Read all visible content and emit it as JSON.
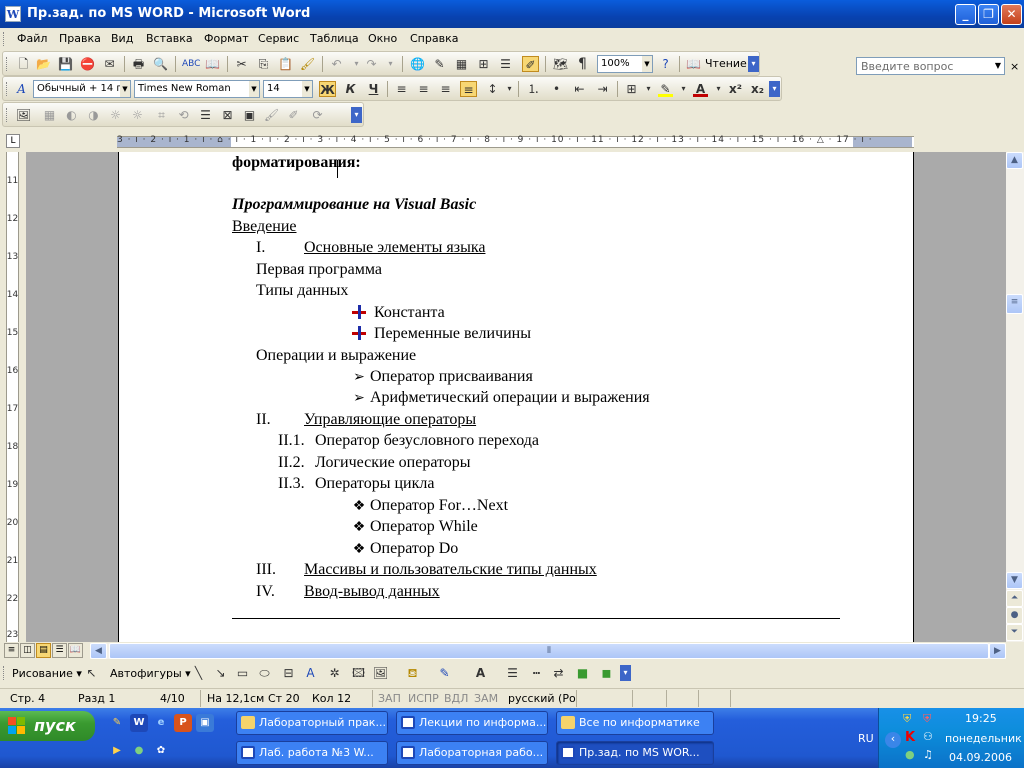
{
  "window": {
    "title": "Пр.зад. по MS WORD - Microsoft Word",
    "app_icon": "W"
  },
  "menu": [
    "Файл",
    "Правка",
    "Вид",
    "Вставка",
    "Формат",
    "Сервис",
    "Таблица",
    "Окно",
    "Справка"
  ],
  "help": {
    "placeholder": "Введите вопрос",
    "close_doc": "×"
  },
  "standard_toolbar": {
    "zoom": "100%",
    "reading_label": "Чтение"
  },
  "formatting_toolbar": {
    "style": "Обычный + 14 г",
    "font": "Times New Roman",
    "size": "14",
    "bold": "Ж",
    "italic": "К",
    "underline": "Ч",
    "highlight_color": "#ffff00",
    "font_color": "#c00000"
  },
  "ruler": {
    "marks": "3 · ı · 2 · ı · 1 · ı · ⌂ · ı · 1 · ı · 2 · ı · 3 · ı · 4 · ı · 5 · ı · 6 · ı · 7 · ı · 8 · ı · 9 · ı · 10 · ı · 11 · ı · 12 · ı · 13 · ı · 14 · ı · 15 · ı · 16 · △ · 17 · ı ·",
    "tab_selector": "L"
  },
  "vruler": [
    "11",
    "12",
    "13",
    "14",
    "15",
    "16",
    "17",
    "18",
    "19",
    "20",
    "21",
    "22",
    "23"
  ],
  "document": {
    "line_top": "форматирования:",
    "heading": "Программирование на Visual Basic",
    "intro": "Введение",
    "s1_num": "I.",
    "s1_title": "Основные элементы языка",
    "first_program": "Первая программа",
    "data_types": "Типы данных",
    "constant": "Константа",
    "variables": "Переменные величины",
    "operations": "Операции и выражение",
    "assign": "Оператор присваивания",
    "arith": "Арифметический операции и выражения",
    "s2_num": "II.",
    "s2_title": "Управляющие операторы",
    "s21_num": "II.1.",
    "s21": "Оператор безусловного перехода",
    "s22_num": "II.2.",
    "s22": "Логические операторы",
    "s23_num": "II.3.",
    "s23": "Операторы цикла",
    "for_next": "Оператор For…Next",
    "while": "Оператор While",
    "do": "Оператор Do",
    "s3_num": "III.",
    "s3_title": "Массивы и пользовательские типы данных",
    "s4_num": "IV.",
    "s4_title": "Ввод-вывод данных"
  },
  "drawing": {
    "draw_label": "Рисование",
    "autoshapes_label": "Автофигуры"
  },
  "status": {
    "page": "Стр. 4",
    "section": "Разд 1",
    "pages": "4/10",
    "at": "На 12,1см",
    "line": "Ст 20",
    "col": "Кол 12",
    "rec": "ЗАП",
    "trk": "ИСПР",
    "ext": "ВДЛ",
    "ovr": "ЗАМ",
    "lang": "русский (Ро"
  },
  "taskbar": {
    "start": "пуск",
    "row1": [
      "Лабораторный прак...",
      "Лекции по информа...",
      "Все по информатике"
    ],
    "row2": [
      "Лаб. работа №3 W...",
      "Лабораторная рабо...",
      "Пр.зад. по MS WOR..."
    ],
    "lang": "RU",
    "time": "19:25",
    "day": "понедельник",
    "date": "04.09.2006"
  }
}
